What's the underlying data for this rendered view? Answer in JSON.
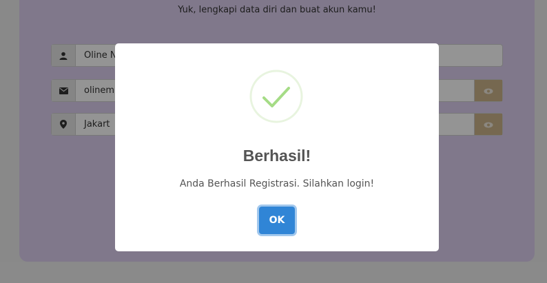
{
  "page": {
    "subtitle": "Yuk, lengkapi data diri dan buat akun kamu!"
  },
  "form": {
    "fields": [
      {
        "icon": "user-icon",
        "value": "Oline N"
      },
      {
        "icon": "envelope-icon",
        "value": "olinem"
      },
      {
        "icon": "map-marker-icon",
        "value": "Jakart"
      }
    ]
  },
  "modal": {
    "icon": "success-check-icon",
    "title": "Berhasil!",
    "message": "Anda Berhasil Registrasi. Silahkan login!",
    "ok_label": "OK"
  },
  "colors": {
    "card_bg": "#dccff0",
    "overlay": "rgba(0,0,0,0.42)",
    "ok_button": "#3085d6",
    "success_green": "#a5dc86",
    "eye_button": "#cbb48a"
  }
}
